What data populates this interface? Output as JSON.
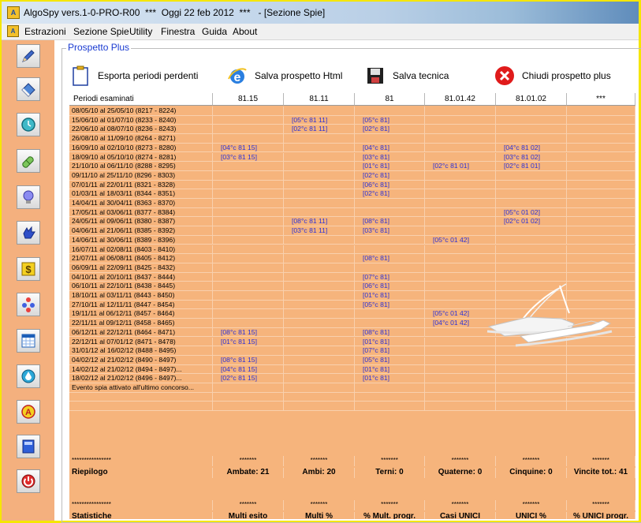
{
  "window": {
    "title": "AlgoSpy vers.1-0-PRO-R00  ***  Oggi 22 feb 2012  ***   - [Sezione Spie]"
  },
  "menu": [
    "Estrazioni",
    "Sezione Spie",
    "Utility",
    "Finestra",
    "Guida",
    "About"
  ],
  "sidebar_icons": [
    "pencil-icon",
    "eraser-icon",
    "clock-icon",
    "pill-icon",
    "lightbulb-icon",
    "hand-icon",
    "dollar-icon",
    "tree-icon",
    "calendar-icon",
    "drop-icon",
    "a-circle-icon",
    "book-icon",
    "power-icon"
  ],
  "group": {
    "title": "Prospetto Plus"
  },
  "toolbar": {
    "export": "Esporta periodi perdenti",
    "save_html": "Salva prospetto Html",
    "save_tech": "Salva tecnica",
    "close": "Chiudi prospetto plus"
  },
  "table": {
    "headers": [
      "Periodi esaminati",
      "81.15",
      "81.11",
      "81",
      "81.01.42",
      "81.01.02",
      "***"
    ],
    "rows": [
      [
        "08/05/10 al 25/05/10  (8217 - 8224)",
        "",
        "",
        "",
        "",
        "",
        ""
      ],
      [
        "15/06/10 al 01/07/10  (8233 - 8240)",
        "",
        "[05°c 81 11]",
        "[05°c 81]",
        "",
        "",
        ""
      ],
      [
        "22/06/10 al 08/07/10  (8236 - 8243)",
        "",
        "[02°c 81 11]",
        "[02°c 81]",
        "",
        "",
        ""
      ],
      [
        "26/08/10 al 11/09/10  (8264 - 8271)",
        "",
        "",
        "",
        "",
        "",
        ""
      ],
      [
        "16/09/10 al 02/10/10  (8273 - 8280)",
        "[04°c 81 15]",
        "",
        "[04°c 81]",
        "",
        "[04°c 81 02]",
        ""
      ],
      [
        "18/09/10 al 05/10/10  (8274 - 8281)",
        "[03°c 81 15]",
        "",
        "[03°c 81]",
        "",
        "[03°c 81 02]",
        ""
      ],
      [
        "21/10/10 al 06/11/10  (8288 - 8295)",
        "",
        "",
        "[01°c 81]",
        "[02°c 81 01]",
        "[02°c 81 01]",
        ""
      ],
      [
        "09/11/10 al 25/11/10  (8296 - 8303)",
        "",
        "",
        "[02°c 81]",
        "",
        "",
        ""
      ],
      [
        "07/01/11 al 22/01/11  (8321 - 8328)",
        "",
        "",
        "[06°c 81]",
        "",
        "",
        ""
      ],
      [
        "01/03/11 al 18/03/11  (8344 - 8351)",
        "",
        "",
        "[02°c 81]",
        "",
        "",
        ""
      ],
      [
        "14/04/11 al 30/04/11  (8363 - 8370)",
        "",
        "",
        "",
        "",
        "",
        ""
      ],
      [
        "17/05/11 al 03/06/11  (8377 - 8384)",
        "",
        "",
        "",
        "",
        "[05°c 01 02]",
        ""
      ],
      [
        "24/05/11 al 09/06/11  (8380 - 8387)",
        "",
        "[08°c 81 11]",
        "[08°c 81]",
        "",
        "[02°c 01 02]",
        ""
      ],
      [
        "04/06/11 al 21/06/11  (8385 - 8392)",
        "",
        "[03°c 81 11]",
        "[03°c 81]",
        "",
        "",
        ""
      ],
      [
        "14/06/11 al 30/06/11  (8389 - 8396)",
        "",
        "",
        "",
        "[05°c 01 42]",
        "",
        ""
      ],
      [
        "16/07/11 al 02/08/11  (8403 - 8410)",
        "",
        "",
        "",
        "",
        "",
        ""
      ],
      [
        "21/07/11 al 06/08/11  (8405 - 8412)",
        "",
        "",
        "[08°c 81]",
        "",
        "",
        ""
      ],
      [
        "06/09/11 al 22/09/11  (8425 - 8432)",
        "",
        "",
        "",
        "",
        "",
        ""
      ],
      [
        "04/10/11 al 20/10/11  (8437 - 8444)",
        "",
        "",
        "[07°c 81]",
        "",
        "",
        ""
      ],
      [
        "06/10/11 al 22/10/11  (8438 - 8445)",
        "",
        "",
        "[06°c 81]",
        "",
        "",
        ""
      ],
      [
        "18/10/11 al 03/11/11  (8443 - 8450)",
        "",
        "",
        "[01°c 81]",
        "",
        "",
        ""
      ],
      [
        "27/10/11 al 12/11/11  (8447 - 8454)",
        "",
        "",
        "[05°c 81]",
        "",
        "",
        ""
      ],
      [
        "19/11/11 al 06/12/11  (8457 - 8464)",
        "",
        "",
        "",
        "[05°c 01 42]",
        "",
        ""
      ],
      [
        "22/11/11 al 09/12/11  (8458 - 8465)",
        "",
        "",
        "",
        "[04°c 01 42]",
        "",
        ""
      ],
      [
        "06/12/11 al 22/12/11  (8464 - 8471)",
        "[08°c 81 15]",
        "",
        "[08°c 81]",
        "",
        "",
        ""
      ],
      [
        "22/12/11 al 07/01/12  (8471 - 8478)",
        "[01°c 81 15]",
        "",
        "[01°c 81]",
        "",
        "",
        ""
      ],
      [
        "31/01/12 al 16/02/12  (8488 - 8495)",
        "",
        "",
        "[07°c 81]",
        "",
        "",
        ""
      ],
      [
        "04/02/12 al 21/02/12  (8490 - 8497)",
        "[08°c 81 15]",
        "",
        "[05°c 81]",
        "",
        "",
        ""
      ],
      [
        "14/02/12 al 21/02/12  (8494 - 8497)...",
        "[04°c 81 15]",
        "",
        "[01°c 81]",
        "",
        "",
        ""
      ],
      [
        "18/02/12 al 21/02/12  (8496 - 8497)...",
        "[02°c 81 15]",
        "",
        "[01°c 81]",
        "",
        "",
        ""
      ],
      [
        "Evento spia attivato all'ultimo concorso...",
        "",
        "",
        "",
        "",
        "",
        ""
      ],
      [
        "",
        "",
        "",
        "",
        "",
        "",
        ""
      ],
      [
        "",
        "",
        "",
        "",
        "",
        "",
        ""
      ]
    ],
    "summary_stars": [
      "****************",
      "*******",
      "*******",
      "*******",
      "*******",
      "*******",
      "*******"
    ],
    "riepilogo": [
      "Riepilogo",
      "Ambate: 21",
      "Ambi: 20",
      "Terni: 0",
      "Quaterne: 0",
      "Cinquine: 0",
      "Vincite tot.: 41"
    ],
    "stat_stars": [
      "****************",
      "*******",
      "*******",
      "*******",
      "*******",
      "*******",
      "*******"
    ],
    "statistiche": [
      "Statistiche",
      "Multi esito",
      "Multi %",
      "% Mult. progr.",
      "Casi UNICI",
      "UNICI %",
      "% UNICI progr."
    ]
  }
}
